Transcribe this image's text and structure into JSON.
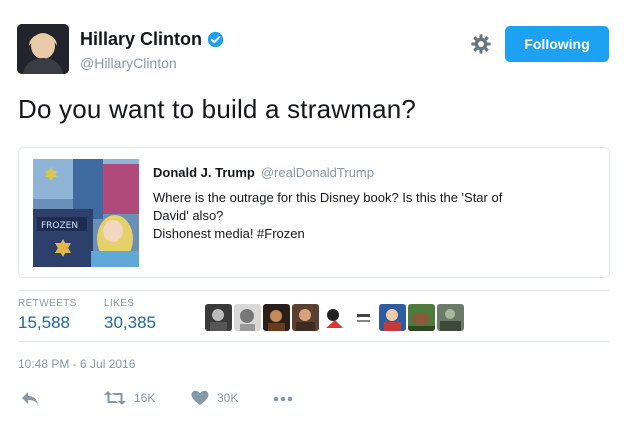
{
  "header": {
    "display_name": "Hillary Clinton",
    "handle": "@HillaryClinton",
    "follow_label": "Following"
  },
  "tweet": {
    "text": "Do you want to build a strawman?"
  },
  "quoted_tweet": {
    "name": "Donald J. Trump",
    "handle": "@realDonaldTrump",
    "lines": [
      "Where is the outrage for this Disney book? Is this the 'Star of",
      "David' also?",
      "Dishonest media! #Frozen"
    ]
  },
  "stats": {
    "retweets_label": "RETWEETS",
    "retweets_value": "15,588",
    "likes_label": "LIKES",
    "likes_value": "30,385"
  },
  "likers": [
    "liker-avatar-1",
    "liker-avatar-2",
    "liker-avatar-3",
    "liker-avatar-4",
    "liker-avatar-5",
    "liker-avatar-6",
    "liker-avatar-7",
    "liker-avatar-8",
    "liker-avatar-9"
  ],
  "timestamp": "10:48 PM - 6 Jul 2016",
  "actions": {
    "retweet_count": "16K",
    "like_count": "30K"
  },
  "icons": {
    "verified": "verified-badge-icon",
    "settings": "gear-icon",
    "reply": "reply-icon",
    "retweet": "retweet-icon",
    "like": "heart-icon",
    "more": "more-dots-icon"
  },
  "colors": {
    "accent": "#1da1f2",
    "link_value": "#1f66a6",
    "muted": "#8899a6",
    "border": "#e1e8ed",
    "text": "#14171a"
  }
}
